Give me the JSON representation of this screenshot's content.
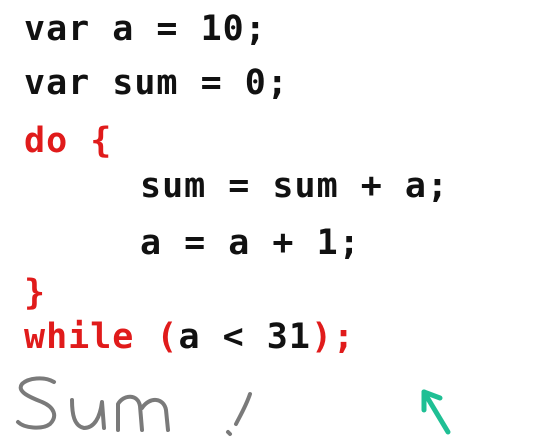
{
  "code": {
    "line1": "var a = 10;",
    "line2": "var sum = 0;",
    "line3": "do {",
    "line4": "sum = sum + a;",
    "line5": "a = a + 1;",
    "line6": "}",
    "line7": {
      "keyword": "while (",
      "condition": "a < 31",
      "close": ");"
    }
  },
  "annotation": {
    "handwritten_text": "sum!",
    "arrow_icon": "arrow-up-left-icon"
  },
  "colors": {
    "text_black": "#111111",
    "keyword_red": "#e01b1b",
    "handwriting_gray": "#7a7a7a",
    "arrow_teal": "#1fbf94"
  }
}
